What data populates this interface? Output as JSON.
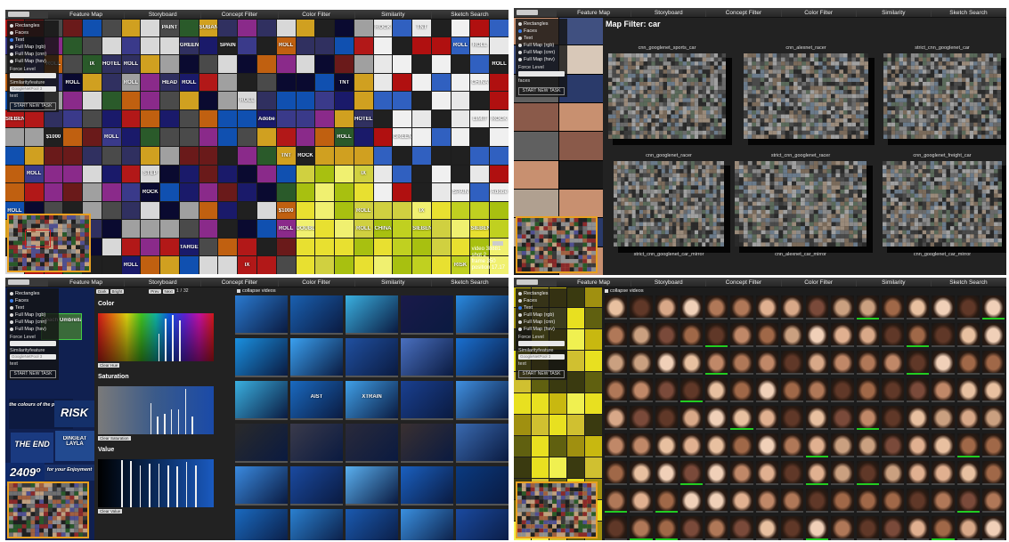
{
  "tabs": [
    "Feature Map",
    "Storyboard",
    "Concept Filter",
    "Color Filter",
    "Similarity",
    "Sketch Search"
  ],
  "side_panel": {
    "options": [
      "Rectangles",
      "Faces",
      "Text",
      "Full Map (rgb)",
      "Full Map (cnn)",
      "Full Map (hsv)"
    ],
    "force_label": "Force Level",
    "sim_label": "Similarityfeature",
    "sim_value": "GoogleNetPool 3",
    "text_label": "text",
    "faces_label": "faces",
    "button": "START NEW TASK"
  },
  "panel1": {
    "selected_option": 2,
    "wall_labels": [
      "ROLL",
      "ROLL",
      "ROLL",
      "IX",
      "HEAD",
      "RISK",
      "RISK",
      "TNT",
      "ROCK",
      "ROLL",
      "ROLL",
      "TNT",
      "SIEBEN",
      "CHINA",
      "THE END",
      "$1000",
      "SUBAN",
      "DOUBLE",
      "ROCK",
      "Adobe",
      "STEP",
      "PAINT",
      "HOTEL",
      "TARGET",
      "ROLL",
      "THE END",
      "GREEN",
      "LOUIS",
      "ROLL",
      "ROLL",
      "LIMIT",
      "SPAIN"
    ],
    "info": [
      "video 38881",
      "shot 2",
      "frame 350",
      "position 17.17"
    ]
  },
  "panel2": {
    "selected_option": 1,
    "title": "Map Filter: car",
    "top_maps": [
      "cnn_googlenet_sports_car",
      "cnn_alexnet_racer",
      "strict_cnn_googlenet_car"
    ],
    "bottom_maps": [
      "cnn_googlenet_racer",
      "strict_cnn_googlenet_racer",
      "cnn_googlenet_freight_car"
    ],
    "bottom_labels": [
      "strict_cnn_googlenet_car_mirror",
      "cnn_alexnet_car_mirror",
      "cnn_googlenet_car_mirror"
    ]
  },
  "panel3": {
    "selected_option": 1,
    "controls": {
      "dark": "Dark",
      "bright": "Bright",
      "prev": "Prev",
      "next": "Next",
      "page": "1",
      "slash": "/",
      "total": "32"
    },
    "collapse": "collapse videos",
    "color_title": "Color",
    "clear_hue": "Clear Hue",
    "saturation_title": "Saturation",
    "clear_saturation": "Clear Saturation",
    "value_title": "Value",
    "clear_value": "Clear Value",
    "hue_lines": [
      0.52,
      0.58,
      0.64,
      0.7
    ],
    "sat_lines": [
      0.45,
      0.51,
      0.57,
      0.63,
      0.69,
      0.75,
      0.81
    ],
    "val_lines": [
      0.2,
      0.28,
      0.36,
      0.44,
      0.52,
      0.6,
      0.68,
      0.76,
      0.84
    ],
    "left_wall_text": [
      "Coach Umbrella",
      "the colours of the planets...",
      "RISK",
      "THE END",
      "DINGEAT LAYLA",
      "for your Enjoyment",
      "2409º"
    ],
    "video_text": [
      "AIST",
      "XTRAIN"
    ]
  },
  "panel4": {
    "selected_option": 2,
    "collapse": "collapse videos",
    "sim_label": "Similarityfeature",
    "sim_value": "GoogleNetPool 3"
  },
  "colors": {
    "accent": "#3a7be6",
    "minimap_border": "#e8a020",
    "highlight": "#22cc22"
  }
}
